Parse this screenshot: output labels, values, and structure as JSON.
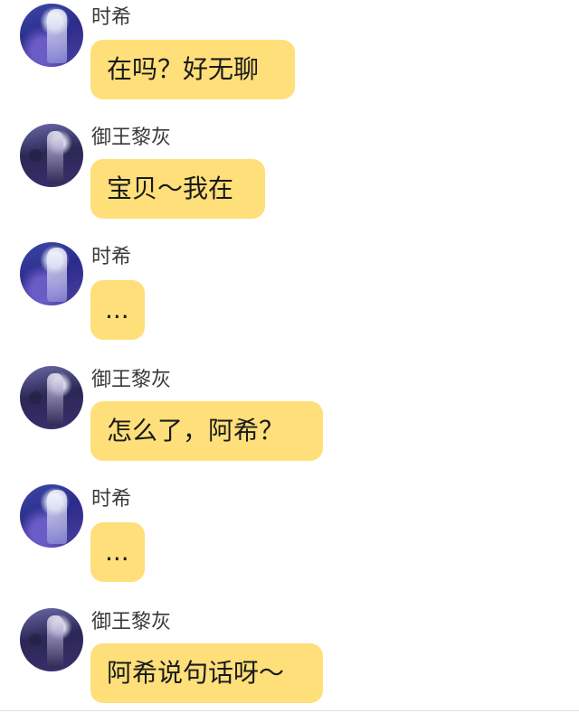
{
  "messages": [
    {
      "sender": "时希",
      "avatar": "shixi-avatar",
      "text": "在吗？好无聊"
    },
    {
      "sender": "御王黎灰",
      "avatar": "yuwang-avatar",
      "text": "宝贝～我在"
    },
    {
      "sender": "时希",
      "avatar": "shixi-avatar",
      "text": "..."
    },
    {
      "sender": "御王黎灰",
      "avatar": "yuwang-avatar",
      "text": "怎么了，阿希？"
    },
    {
      "sender": "时希",
      "avatar": "shixi-avatar",
      "text": "..."
    },
    {
      "sender": "御王黎灰",
      "avatar": "yuwang-avatar",
      "text": "阿希说句话呀～"
    }
  ],
  "colors": {
    "bubble": "#fedf7a",
    "background": "#ffffff",
    "name_text": "#3a3a3a",
    "message_text": "#1a1a1a"
  }
}
